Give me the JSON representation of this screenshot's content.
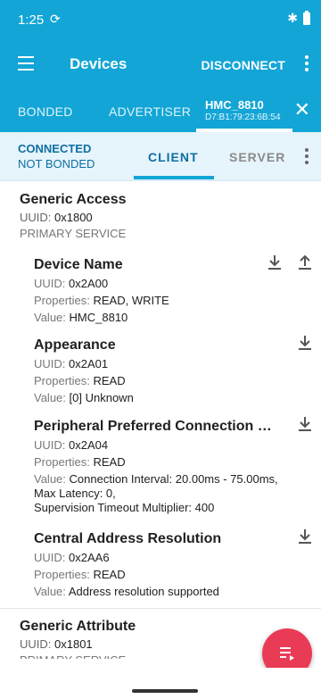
{
  "status": {
    "time": "1:25",
    "sync_icon": "sync-icon",
    "bluetooth_icon": "bluetooth-icon",
    "battery_icon": "battery-icon"
  },
  "appbar": {
    "title": "Devices",
    "disconnect": "DISCONNECT"
  },
  "device_tabs": {
    "bonded": "BONDED",
    "advertiser": "ADVERTISER",
    "device_name": "HMC_8810",
    "device_mac": "D7:B1:79:23:6B:54"
  },
  "session": {
    "connected": "CONNECTED",
    "bond_state": "NOT BONDED",
    "client_tab": "CLIENT",
    "server_tab": "SERVER"
  },
  "labels": {
    "uuid": "UUID:",
    "properties": "Properties:",
    "value": "Value:"
  },
  "services": [
    {
      "name": "Generic Access",
      "uuid": "0x1800",
      "type": "PRIMARY SERVICE",
      "characteristics": [
        {
          "name": "Device Name",
          "uuid": "0x2A00",
          "properties": "READ, WRITE",
          "value": "HMC_8810"
        },
        {
          "name": "Appearance",
          "uuid": "0x2A01",
          "properties": "READ",
          "value": "[0] Unknown"
        },
        {
          "name": "Peripheral Preferred Connection Para…",
          "uuid": "0x2A04",
          "properties": "READ",
          "value_line1": "Connection Interval: 20.00ms - 75.00ms,",
          "value_line2": "Max Latency: 0,",
          "value_line3": "Supervision Timeout Multiplier: 400"
        },
        {
          "name": "Central Address Resolution",
          "uuid": "0x2AA6",
          "properties": "READ",
          "value": "Address resolution supported"
        }
      ]
    },
    {
      "name": "Generic Attribute",
      "uuid": "0x1801",
      "type": "PRIMARY SERVICE"
    }
  ],
  "fab": {
    "icon": "log-icon"
  },
  "accent_colors": {
    "primary": "#13a5d6",
    "fab": "#ea3b56"
  }
}
